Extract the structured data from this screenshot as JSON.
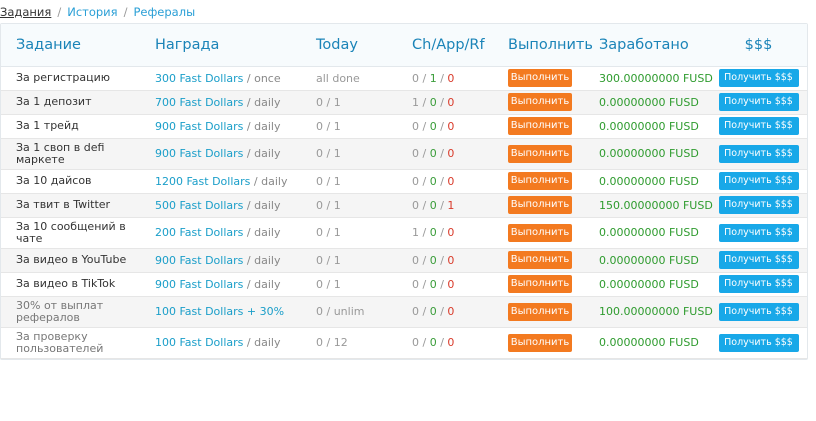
{
  "breadcrumb": {
    "items": [
      "Задания",
      "История",
      "Рефералы"
    ],
    "separator": "/"
  },
  "table": {
    "headers": {
      "task": "Задание",
      "reward": "Награда",
      "today": "Today",
      "counts": "Ch/App/Rf",
      "action": "Выполнить",
      "earned": "Заработано",
      "usd": "$$$"
    },
    "rows": [
      {
        "task": "За регистрацию",
        "reward": "300 Fast Dollars",
        "period": " / once",
        "today": "all done",
        "ch": "0",
        "app": "1",
        "rf": "0",
        "action": "Выполнить",
        "earned": "300.00000000 FUSD",
        "get": "Получить $$$"
      },
      {
        "task": "За 1 депозит",
        "reward": "700 Fast Dollars",
        "period": " / daily",
        "today": "0 / 1",
        "ch": "1",
        "app": "0",
        "rf": "0",
        "action": "Выполнить",
        "earned": "0.00000000 FUSD",
        "get": "Получить $$$"
      },
      {
        "task": "За 1 трейд",
        "reward": "900 Fast Dollars",
        "period": " / daily",
        "today": "0 / 1",
        "ch": "0",
        "app": "0",
        "rf": "0",
        "action": "Выполнить",
        "earned": "0.00000000 FUSD",
        "get": "Получить $$$"
      },
      {
        "task": "За 1 своп в defi маркете",
        "reward": "900 Fast Dollars",
        "period": " / daily",
        "today": "0 / 1",
        "ch": "0",
        "app": "0",
        "rf": "0",
        "action": "Выполнить",
        "earned": "0.00000000 FUSD",
        "get": "Получить $$$"
      },
      {
        "task": "За 10 дайсов",
        "reward": "1200 Fast Dollars",
        "period": " / daily",
        "today": "0 / 1",
        "ch": "0",
        "app": "0",
        "rf": "0",
        "action": "Выполнить",
        "earned": "0.00000000 FUSD",
        "get": "Получить $$$"
      },
      {
        "task": "За твит в Twitter",
        "reward": "500 Fast Dollars",
        "period": " / daily",
        "today": "0 / 1",
        "ch": "0",
        "app": "0",
        "rf": "1",
        "action": "Выполнить",
        "earned": "150.00000000 FUSD",
        "get": "Получить $$$"
      },
      {
        "task": "За 10 сообщений в чате",
        "reward": "200 Fast Dollars",
        "period": " / daily",
        "today": "0 / 1",
        "ch": "1",
        "app": "0",
        "rf": "0",
        "action": "Выполнить",
        "earned": "0.00000000 FUSD",
        "get": "Получить $$$"
      },
      {
        "task": "За видео в YouTube",
        "reward": "900 Fast Dollars",
        "period": " / daily",
        "today": "0 / 1",
        "ch": "0",
        "app": "0",
        "rf": "0",
        "action": "Выполнить",
        "earned": "0.00000000 FUSD",
        "get": "Получить $$$"
      },
      {
        "task": "За видео в TikTok",
        "reward": "900 Fast Dollars",
        "period": " / daily",
        "today": "0 / 1",
        "ch": "0",
        "app": "0",
        "rf": "0",
        "action": "Выполнить",
        "earned": "0.00000000 FUSD",
        "get": "Получить $$$"
      },
      {
        "task": "30% от выплат рефералов",
        "reward": "100 Fast Dollars + 30%",
        "period": "",
        "today": "0 / unlim",
        "ch": "0",
        "app": "0",
        "rf": "0",
        "action": "Выполнить",
        "earned": "100.00000000 FUSD",
        "get": "Получить $$$",
        "muted": true
      },
      {
        "task": "За проверку пользователей",
        "reward": "100 Fast Dollars",
        "period": " / daily",
        "today": "0 / 12",
        "ch": "0",
        "app": "0",
        "rf": "0",
        "action": "Выполнить",
        "earned": "0.00000000 FUSD",
        "get": "Получить $$$",
        "muted": true
      }
    ]
  }
}
